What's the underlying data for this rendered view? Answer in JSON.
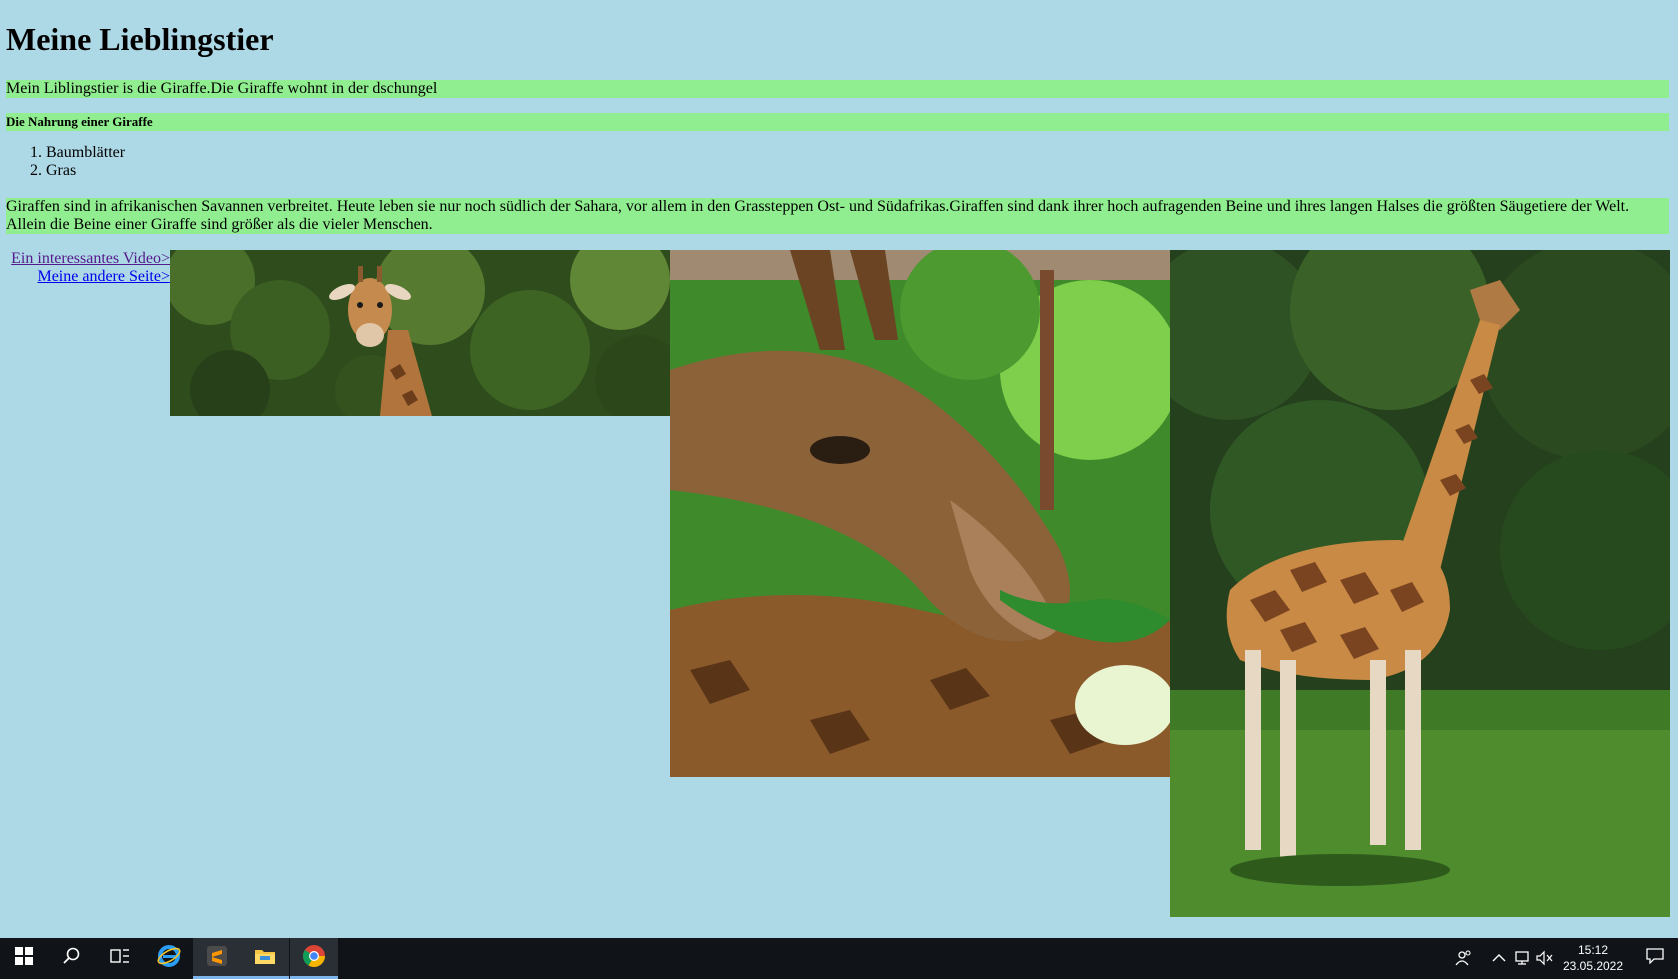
{
  "page": {
    "title": "Meine Lieblingstier",
    "intro": "Mein Liblingstier is die Giraffe.Die Giraffe wohnt in der dschungel",
    "food_heading": "Die Nahrung einer Giraffe",
    "food_items": [
      "Baumblätter",
      "Gras"
    ],
    "facts": "Giraffen sind in afrikanischen Savannen verbreitet. Heute leben sie nur noch südlich der Sahara, vor allem in den Grassteppen Ost- und Südafrikas.Giraffen sind dank ihrer hoch aufragenden Beine und ihres langen Halses die größten Säugetiere der Welt. Allein die Beine einer Giraffe sind größer als die vieler Menschen.",
    "links": [
      {
        "label": "Ein interessantes Video>",
        "visited": true
      },
      {
        "label": "Meine andere Seite>",
        "visited": false
      }
    ],
    "images": [
      "giraffe-head-trees",
      "giraffe-eating-leaves",
      "giraffe-standing-grass"
    ],
    "colors": {
      "background": "#add8e6",
      "highlight": "#90ee90",
      "link": "#0000ee",
      "visited_link": "#551a8b"
    }
  },
  "taskbar": {
    "apps": [
      "start-icon",
      "search-icon",
      "task-view-icon",
      "internet-explorer-icon",
      "sublime-text-icon",
      "file-explorer-icon",
      "chrome-icon"
    ],
    "active_app": "chrome-icon",
    "tray": [
      "people-icon",
      "chevron-up-icon",
      "network-icon",
      "volume-muted-icon"
    ],
    "time": "15:12",
    "date": "23.05.2022"
  }
}
